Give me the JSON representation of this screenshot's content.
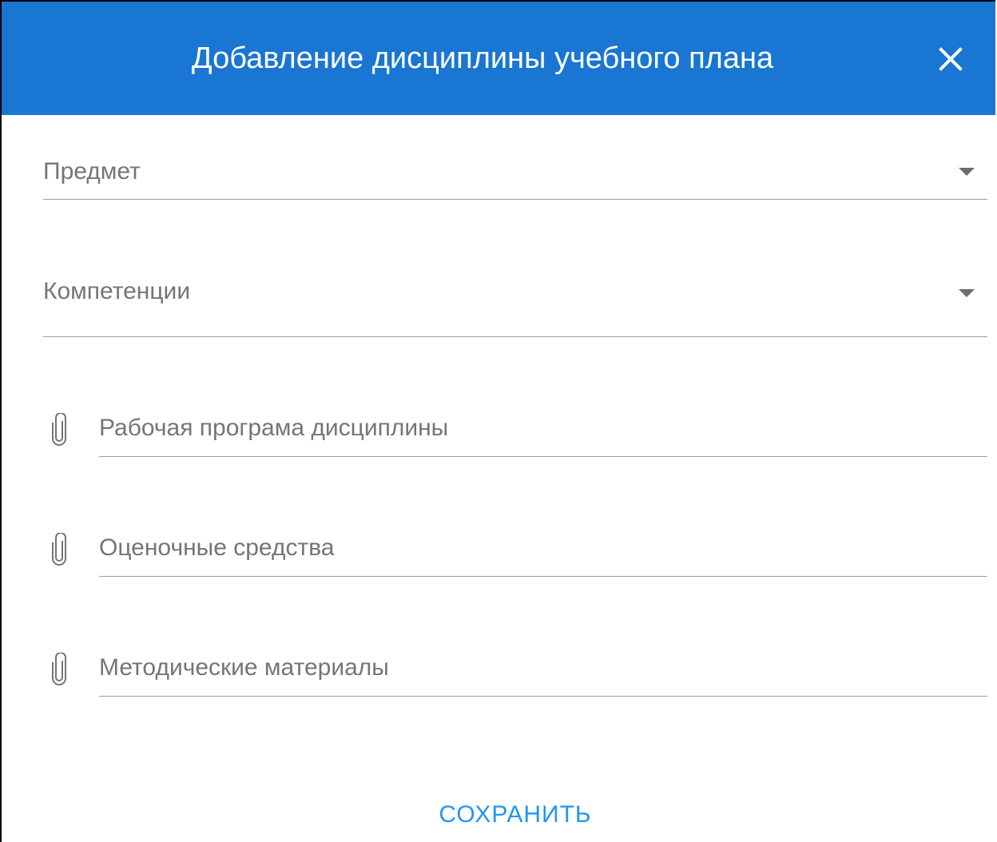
{
  "dialog": {
    "title": "Добавление дисциплины учебного плана",
    "close_icon": "close-icon"
  },
  "fields": {
    "subject": {
      "label": "Предмет",
      "icon": "chevron-down-icon"
    },
    "competencies": {
      "label": "Компетенции",
      "icon": "chevron-down-icon"
    }
  },
  "files": {
    "work_program": {
      "label": "Рабочая програма дисциплины",
      "icon": "paperclip-icon"
    },
    "assessment": {
      "label": "Оценочные средства",
      "icon": "paperclip-icon"
    },
    "methodical": {
      "label": "Методические материалы",
      "icon": "paperclip-icon"
    }
  },
  "actions": {
    "save_label": "СОХРАНИТЬ"
  },
  "colors": {
    "header_bg": "#1976d2",
    "accent": "#2196f3",
    "label": "#757575",
    "underline": "#9e9e9e"
  }
}
